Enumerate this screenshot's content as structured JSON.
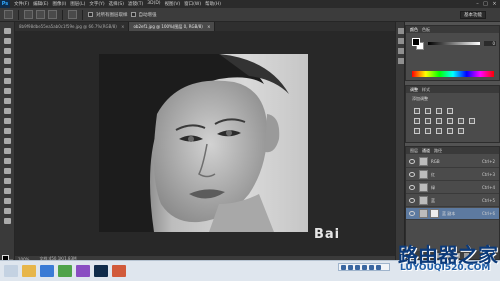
{
  "app": {
    "logo": "Ps"
  },
  "menu": [
    "文件(F)",
    "编辑(E)",
    "图像(I)",
    "图层(L)",
    "文字(Y)",
    "选择(S)",
    "滤镜(T)",
    "3D(D)",
    "视图(V)",
    "窗口(W)",
    "帮助(H)"
  ],
  "options_bar": {
    "sample_all_label": "对所有图层取样",
    "auto_enhance_label": "自动增强",
    "workspace": "基本功能"
  },
  "tabs": [
    {
      "label": "8b9f98dbe55ea5ab0c1f59e.jpg @ 66.7%(RGB/8)",
      "close": "×"
    },
    {
      "label": "ob2ef1.jpg @ 100%(图层 0, RGB/8)",
      "close": "×"
    }
  ],
  "status": {
    "zoom": "100%",
    "doc": "文档:450.1K/1.83M"
  },
  "mini_bridge": {
    "label": "Mini Bridge  时间轴"
  },
  "color_panel": {
    "tabs": [
      "颜色",
      "色板"
    ],
    "value": "0"
  },
  "adjust_panel": {
    "tabs": [
      "调整",
      "样式"
    ],
    "title": "添加调整"
  },
  "layers_panel": {
    "tabs": [
      "图层",
      "通道",
      "路径"
    ],
    "layers": [
      {
        "name": "RGB",
        "shortcut": "Ctrl+2",
        "selected": false
      },
      {
        "name": "红",
        "shortcut": "Ctrl+3",
        "selected": false
      },
      {
        "name": "绿",
        "shortcut": "Ctrl+4",
        "selected": false
      },
      {
        "name": "蓝",
        "shortcut": "Ctrl+5",
        "selected": false
      },
      {
        "name": "蓝 副本",
        "shortcut": "Ctrl+6",
        "selected": true
      }
    ]
  },
  "watermark": {
    "title": "路由器之家",
    "url": "LUYOUQI520.COM",
    "baidu": "Bai"
  },
  "colors": {
    "selected_layer": "#5d7aa0",
    "watermark_blue": "#0b3a7a"
  }
}
